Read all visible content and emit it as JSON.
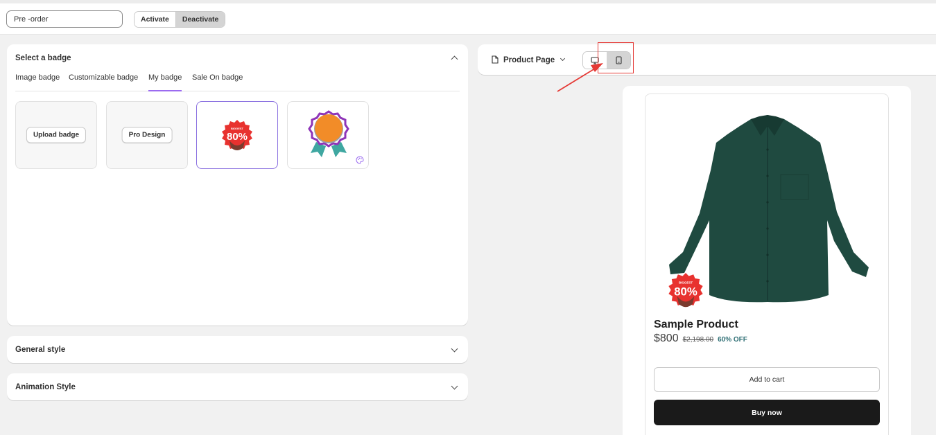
{
  "header": {
    "name_value": "Pre -order",
    "activate_label": "Activate",
    "deactivate_label": "Deactivate",
    "active_state": "Deactivate"
  },
  "badge_panel": {
    "title": "Select a badge",
    "tabs": [
      {
        "label": "Image badge"
      },
      {
        "label": "Customizable badge"
      },
      {
        "label": "My badge"
      },
      {
        "label": "Sale On badge"
      }
    ],
    "active_tab": "My badge",
    "tiles": [
      {
        "type": "button",
        "label": "Upload badge"
      },
      {
        "type": "button",
        "label": "Pro Design"
      },
      {
        "type": "image",
        "icon": "sale-80-percent-badge",
        "badge_text_line1": "BIGGEST",
        "badge_text_line2": "80%",
        "selected": true
      },
      {
        "type": "image",
        "icon": "orange-rosette-badge",
        "extra_icon": "palette-icon",
        "selected": false
      }
    ]
  },
  "accordions": [
    {
      "title": "General style"
    },
    {
      "title": "Animation Style"
    }
  ],
  "preview": {
    "page_select_label": "Product Page",
    "device_options": [
      "desktop",
      "mobile"
    ],
    "active_device": "mobile",
    "product": {
      "name": "Sample Product",
      "price": "$800",
      "compare_price": "$2,198.00",
      "discount": "60% OFF",
      "add_to_cart_label": "Add to cart",
      "buy_now_label": "Buy now",
      "image": "dark-green-long-sleeve-shirt"
    }
  },
  "colors": {
    "accent_purple": "#9b6bf0",
    "highlight_red": "#e53935",
    "shirt_green": "#1f4a40",
    "discount_teal": "#2f6f75",
    "buy_button": "#1a1a1a"
  }
}
